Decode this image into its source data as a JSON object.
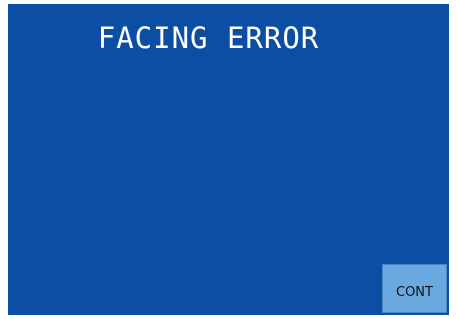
{
  "screen": {
    "title": "FACING ERROR",
    "background_color": "#0c4ea3"
  },
  "buttons": {
    "cont_label": "CONT",
    "cont_color": "#6aa9e0"
  }
}
